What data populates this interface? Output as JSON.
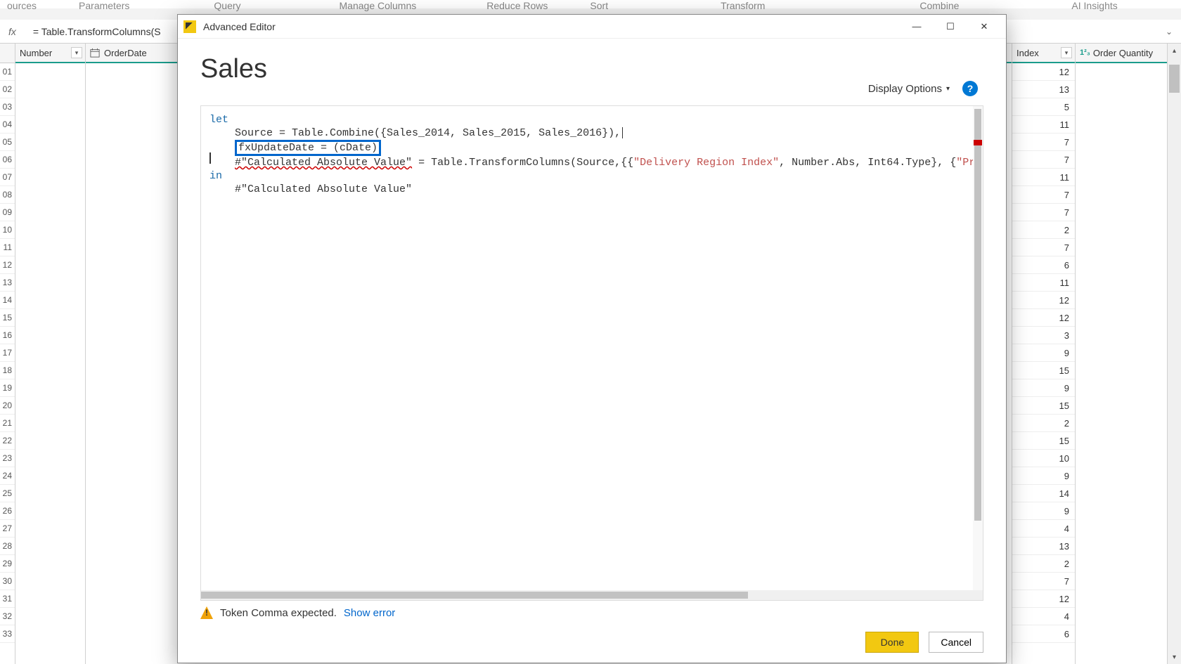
{
  "ribbon": {
    "items": [
      "ources",
      "Parameters",
      "Query",
      "Manage Columns",
      "Reduce Rows",
      "Sort",
      "Transform",
      "Combine",
      "AI Insights"
    ]
  },
  "formula_bar": {
    "fx": "fx",
    "formula": "= Table.TransformColumns(S"
  },
  "grid": {
    "col_a_header": "Number",
    "col_b_header": "OrderDate",
    "col_index_header": "Index",
    "col_qty_header": "Order Quantity",
    "row_numbers": [
      "01",
      "02",
      "03",
      "04",
      "05",
      "06",
      "07",
      "08",
      "09",
      "10",
      "11",
      "12",
      "13",
      "14",
      "15",
      "16",
      "17",
      "18",
      "19",
      "20",
      "21",
      "22",
      "23",
      "24",
      "25",
      "26",
      "27",
      "28",
      "29",
      "30",
      "31",
      "32",
      "33"
    ],
    "index_values": [
      "12",
      "13",
      "5",
      "11",
      "7",
      "7",
      "11",
      "7",
      "7",
      "2",
      "7",
      "6",
      "11",
      "12",
      "12",
      "3",
      "9",
      "15",
      "9",
      "15",
      "2",
      "15",
      "10",
      "9",
      "14",
      "9",
      "4",
      "13",
      "2",
      "7",
      "12",
      "4",
      "6"
    ]
  },
  "modal": {
    "title": "Advanced Editor",
    "query_name": "Sales",
    "display_options": "Display Options",
    "code": {
      "line1_kw": "let",
      "line2_pre": "    Source = Table.Combine({Sales_2014, Sales_2015, Sales_2016}),",
      "line3_highlight": "fxUpdateDate = (cDate)",
      "line4_err": "#\"Calculated Absolute Value\"",
      "line4_mid": " = Table.TransformColumns(Source,{{",
      "line4_str1": "\"Delivery Region Index\"",
      "line4_mid2": ", Number.Abs, Int64.Type}, {",
      "line4_str2": "\"Product Description I",
      "line5_kw": "in",
      "line6": "    #\"Calculated Absolute Value\""
    },
    "status": {
      "message": "Token Comma expected.",
      "link": "Show error"
    },
    "buttons": {
      "done": "Done",
      "cancel": "Cancel"
    }
  }
}
